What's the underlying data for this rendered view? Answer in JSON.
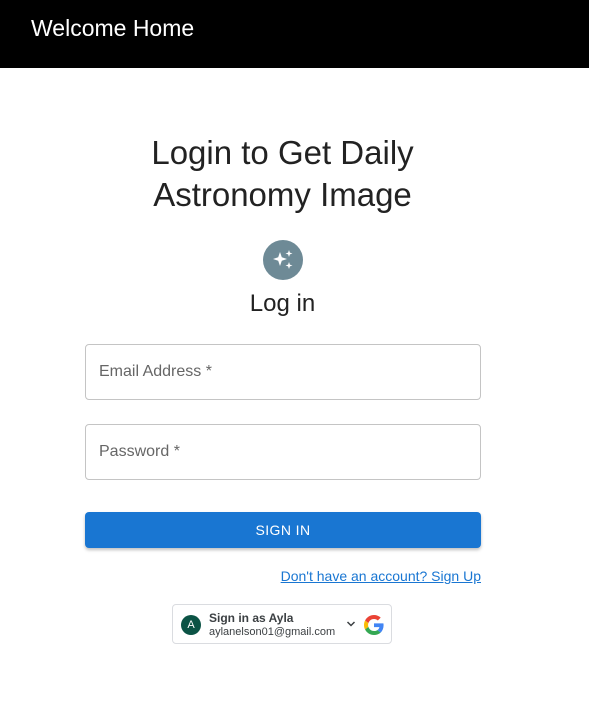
{
  "header": {
    "title": "Welcome Home"
  },
  "main": {
    "headline_line1": "Login to Get Daily",
    "headline_line2": "Astronomy Image",
    "icon": "sparkles-icon",
    "login_heading": "Log in",
    "email": {
      "placeholder": "Email Address *",
      "value": ""
    },
    "password": {
      "placeholder": "Password *",
      "value": ""
    },
    "signin_label": "SIGN IN",
    "signup_link": "Don't have an account? Sign Up"
  },
  "google": {
    "avatar_letter": "A",
    "name_text": "Sign in as Ayla",
    "email_text": "aylanelson01@gmail.com",
    "icons": [
      "chevron-down-icon",
      "google-logo-icon"
    ]
  },
  "colors": {
    "app_bar": "#000000",
    "primary": "#1976d2",
    "icon_bg": "#6e8a96",
    "google_avatar": "#0b5345"
  }
}
